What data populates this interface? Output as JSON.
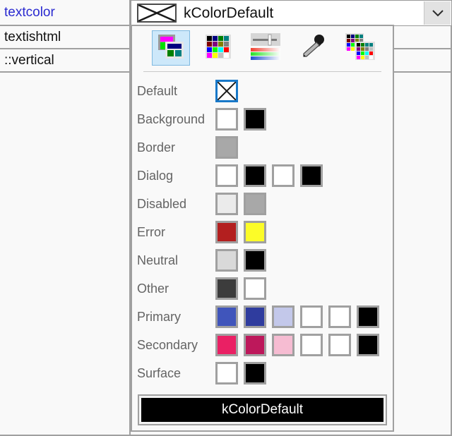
{
  "property_table": {
    "rows": [
      {
        "name": "textcolor",
        "is_link": true
      },
      {
        "name": "textishtml",
        "is_link": false
      },
      {
        "name": "::vertical",
        "is_link": false
      }
    ]
  },
  "combobox": {
    "value": "kColorDefault",
    "swatch_icon": "x-crossed-swatch",
    "arrow_icon": "chevron-down-icon"
  },
  "popup": {
    "toolbar": {
      "items": [
        {
          "icon": "theme-colors-icon",
          "label": "Theme colors",
          "selected": true
        },
        {
          "icon": "color-grid-icon",
          "label": "Color grid",
          "selected": false
        },
        {
          "icon": "sliders-spectrum-icon",
          "label": "Sliders and spectrum",
          "selected": false
        },
        {
          "icon": "eyedropper-icon",
          "label": "Eyedropper",
          "selected": false
        },
        {
          "icon": "custom-palettes-icon",
          "label": "Custom palettes",
          "selected": false
        }
      ]
    },
    "rows": [
      {
        "label": "Default",
        "swatches": [
          {
            "color": "#ffffff",
            "style": "x-mark",
            "selected": true
          }
        ]
      },
      {
        "label": "Background",
        "swatches": [
          {
            "color": "#ffffff"
          },
          {
            "color": "#000000"
          }
        ]
      },
      {
        "label": "Border",
        "swatches": [
          {
            "color": "#a8a8a8"
          }
        ]
      },
      {
        "label": "Dialog",
        "swatches": [
          {
            "color": "#ffffff"
          },
          {
            "color": "#000000"
          },
          {
            "color": "#ffffff"
          },
          {
            "color": "#000000"
          }
        ]
      },
      {
        "label": "Disabled",
        "swatches": [
          {
            "color": "#ebebeb"
          },
          {
            "color": "#a8a8a8"
          }
        ]
      },
      {
        "label": "Error",
        "swatches": [
          {
            "color": "#b31f1f"
          },
          {
            "color": "#fcfc28"
          }
        ]
      },
      {
        "label": "Neutral",
        "swatches": [
          {
            "color": "#d9d9d9"
          },
          {
            "color": "#000000"
          }
        ]
      },
      {
        "label": "Other",
        "swatches": [
          {
            "color": "#3c3c3c"
          },
          {
            "color": "#ffffff"
          }
        ]
      },
      {
        "label": "Primary",
        "swatches": [
          {
            "color": "#4055bb"
          },
          {
            "color": "#2f3c9e"
          },
          {
            "color": "#c3c8ea"
          },
          {
            "color": "#ffffff"
          },
          {
            "color": "#ffffff"
          },
          {
            "color": "#000000"
          }
        ]
      },
      {
        "label": "Secondary",
        "swatches": [
          {
            "color": "#ea2064"
          },
          {
            "color": "#bd185b"
          },
          {
            "color": "#f6bcd2"
          },
          {
            "color": "#ffffff"
          },
          {
            "color": "#ffffff"
          },
          {
            "color": "#000000"
          }
        ]
      },
      {
        "label": "Surface",
        "swatches": [
          {
            "color": "#ffffff"
          },
          {
            "color": "#000000"
          }
        ]
      }
    ],
    "preview": {
      "label": "kColorDefault",
      "background": "#000000",
      "text_color": "#ffffff"
    }
  },
  "theme": {
    "selection_blue": "#1878c8",
    "toolbar_selected_bg": "#cde8fa",
    "border_gray": "#a0a0a0",
    "label_gray": "#646464",
    "link_blue": "#2a2ad0"
  }
}
